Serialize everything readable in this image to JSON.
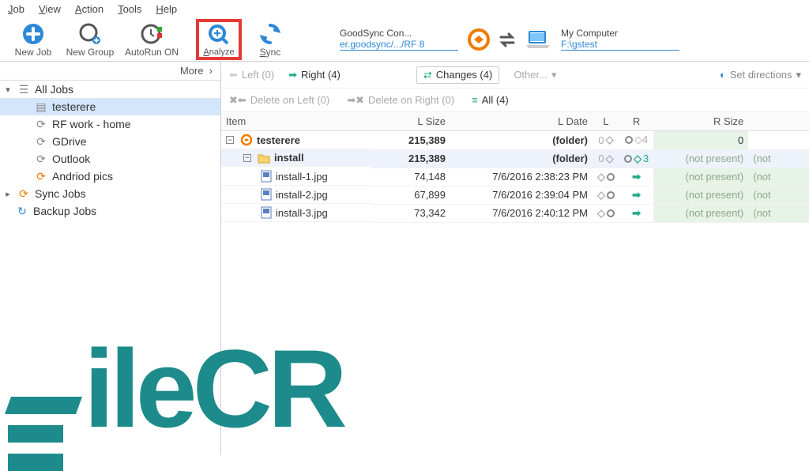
{
  "menu": {
    "job": "Job",
    "view": "View",
    "action": "Action",
    "tools": "Tools",
    "help": "Help"
  },
  "toolbar": {
    "newjob": "New Job",
    "newgroup": "New Group",
    "autorun": "AutoRun ON",
    "analyze": "Analyze",
    "sync": "Sync"
  },
  "conn_left": {
    "title": "GoodSync Con...",
    "path": "er.goodsync/.../RF 8"
  },
  "conn_right": {
    "title": "My Computer",
    "path": "F:\\gstest"
  },
  "sidebar": {
    "more": "More",
    "alljobs": "All Jobs",
    "items": [
      {
        "label": "testerere",
        "sel": true,
        "kind": "doc"
      },
      {
        "label": "RF work - home",
        "kind": "sync-g"
      },
      {
        "label": "GDrive",
        "kind": "sync-g"
      },
      {
        "label": "Outlook",
        "kind": "sync-g"
      },
      {
        "label": "Andriod pics",
        "kind": "sync-o"
      }
    ],
    "syncjobs": "Sync Jobs",
    "backupjobs": "Backup Jobs"
  },
  "filters": {
    "left": "Left (0)",
    "right": "Right (4)",
    "changes": "Changes (4)",
    "other": "Other...",
    "setdir": "Set directions",
    "del_left": "Delete on Left (0)",
    "del_right": "Delete on Right (0)",
    "all": "All (4)"
  },
  "columns": {
    "item": "Item",
    "lsize": "L Size",
    "ldate": "L Date",
    "l": "L",
    "r": "R",
    "rsize": "R Size"
  },
  "rows": [
    {
      "type": "root",
      "name": "testerere",
      "lsize": "215,389",
      "ldate": "(folder)",
      "rsize": "0",
      "indent": 0
    },
    {
      "type": "folder",
      "name": "install",
      "lsize": "215,389",
      "ldate": "(folder)",
      "rsize": "(not present)",
      "indent": 1
    },
    {
      "type": "file",
      "name": "install-1.jpg",
      "lsize": "74,148",
      "ldate": "7/6/2016 2:38:23 PM",
      "rsize": "(not present)",
      "indent": 2
    },
    {
      "type": "file",
      "name": "install-2.jpg",
      "lsize": "67,899",
      "ldate": "7/6/2016 2:39:04 PM",
      "rsize": "(not present)",
      "indent": 2
    },
    {
      "type": "file",
      "name": "install-3.jpg",
      "lsize": "73,342",
      "ldate": "7/6/2016 2:40:12 PM",
      "rsize": "(not present)",
      "indent": 2
    }
  ],
  "watermark": "ileCR",
  "cutoff": "(not"
}
